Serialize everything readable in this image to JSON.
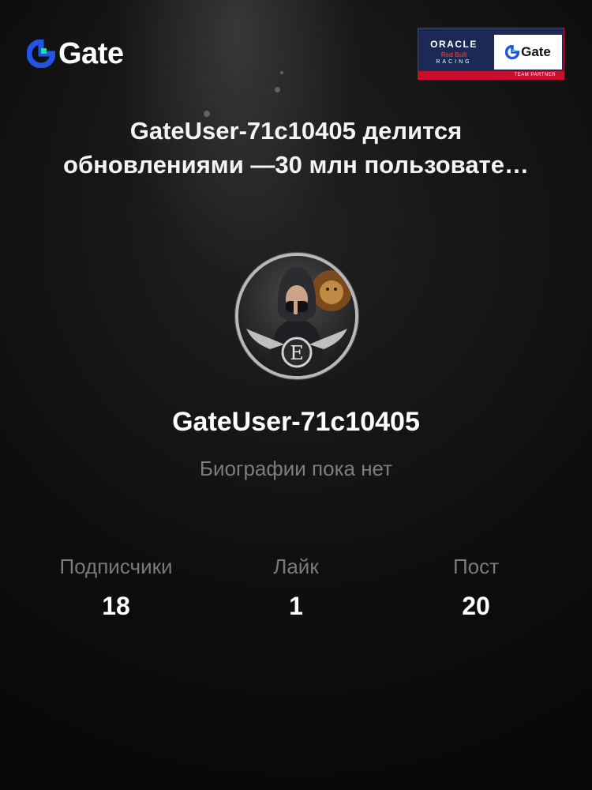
{
  "brand": {
    "name": "Gate",
    "accent_color": "#2354e6",
    "accent_color_2": "#17e0a1"
  },
  "partner_badge": {
    "oracle": "ORACLE",
    "redbull": "Red Bull",
    "racing": "RACING",
    "gate": "Gate",
    "strip": "TEAM PARTNER"
  },
  "headline": "GateUser-71c10405 делится обновлениями —30 млн пользовате…",
  "profile": {
    "avatar_icon": "user-avatar-hooded-figure-lion",
    "username": "GateUser-71c10405",
    "bio": "Биографии пока нет"
  },
  "stats": [
    {
      "label": "Подписчики",
      "value": "18"
    },
    {
      "label": "Лайк",
      "value": "1"
    },
    {
      "label": "Пост",
      "value": "20"
    }
  ]
}
